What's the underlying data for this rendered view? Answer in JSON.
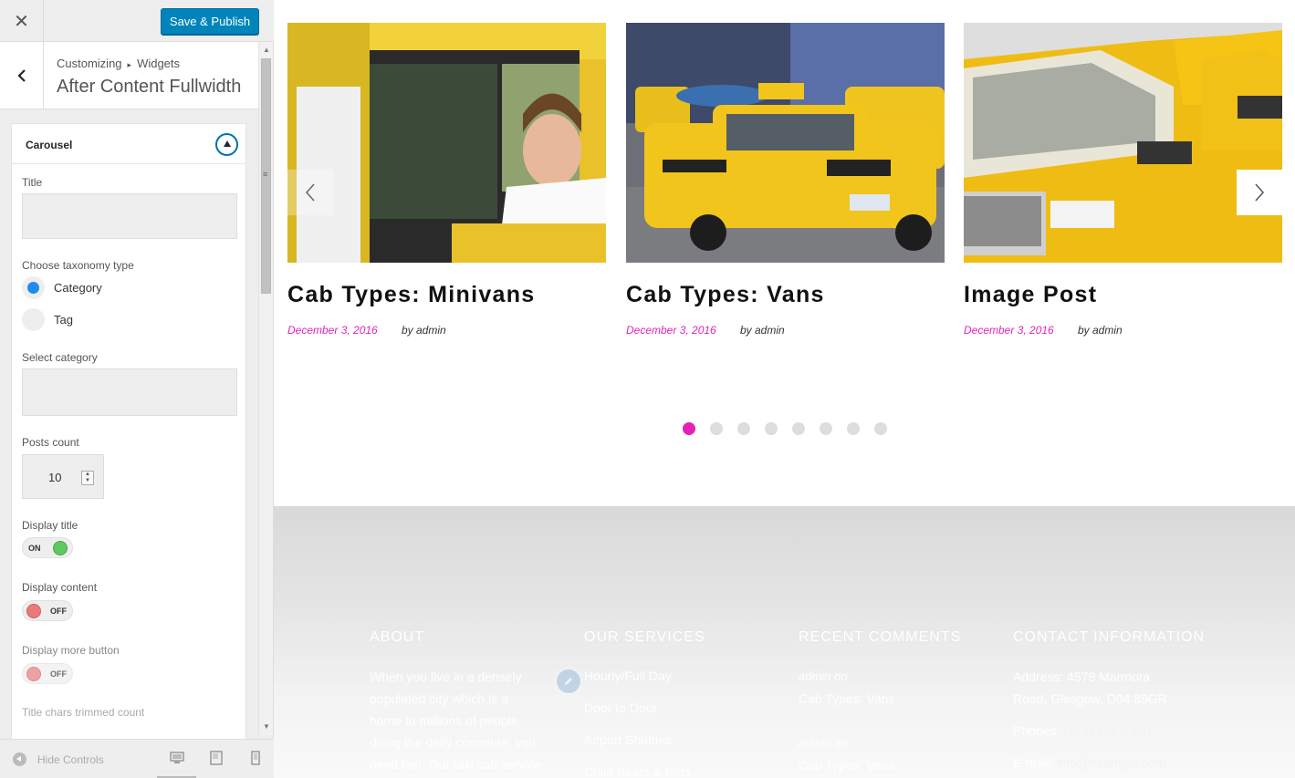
{
  "topbar": {
    "close_label": "✕",
    "publish_label": "Save & Publish"
  },
  "section": {
    "breadcrumb_parent": "Customizing",
    "breadcrumb_child": "Widgets",
    "title": "After Content Fullwidth"
  },
  "widget": {
    "title": "Carousel",
    "fields": {
      "title_label": "Title",
      "title_value": "",
      "taxonomy_label": "Choose taxonomy type",
      "taxonomy_options": [
        "Category",
        "Tag"
      ],
      "taxonomy_selected": "Category",
      "category_label": "Select category",
      "category_value": "",
      "posts_count_label": "Posts count",
      "posts_count_value": "10",
      "display_title_label": "Display title",
      "display_title_state": "ON",
      "display_content_label": "Display content",
      "display_content_state": "OFF",
      "display_more_label": "Display more button",
      "display_more_state": "OFF",
      "title_chars_label": "Title chars trimmed count"
    }
  },
  "controls": {
    "hide_label": "Hide Controls",
    "devices": [
      "desktop-icon",
      "tablet-icon",
      "mobile-icon"
    ]
  },
  "carousel": {
    "posts": [
      {
        "title": "Cab Types: Minivans",
        "date": "December 3, 2016",
        "author": "by admin"
      },
      {
        "title": "Cab Types: Vans",
        "date": "December 3, 2016",
        "author": "by admin"
      },
      {
        "title": "Image Post",
        "date": "December 3, 2016",
        "author": "by admin"
      }
    ],
    "dots_total": 8,
    "dots_active": 1
  },
  "footer": {
    "about": {
      "heading": "ABOUT",
      "text_lines": [
        "When you live in a densely",
        "populated city which is a",
        "home to millions of people",
        "doing the daily commute, you",
        "need taxi. Our taxi cab service"
      ]
    },
    "services": {
      "heading": "OUR SERVICES",
      "links": [
        "Hourly/Full Day",
        "Door to Door",
        "Airport Shuttles",
        "Child Seats & Pets"
      ]
    },
    "comments": {
      "heading": "RECENT COMMENTS",
      "items": [
        {
          "meta": "admin  on",
          "link": "Cab Types: Vans"
        },
        {
          "meta": "admin  on",
          "link": "Cab Types: Vans"
        }
      ]
    },
    "contact": {
      "heading": "CONTACT INFORMATION",
      "address_lines": [
        "Address: 4578 Marmora",
        "Road, Glasgow, D04 89GR"
      ],
      "phones_label": "Phones:",
      "phones_value": "(123) 456-7890",
      "email_label": "E-mail:",
      "email_value": "info@example.com"
    }
  },
  "colors": {
    "accent": "#e323b8",
    "publish": "#0085ba",
    "switch_on": "#5fc861",
    "switch_off": "#e87a7a",
    "radio_on": "#1e8cf0"
  }
}
